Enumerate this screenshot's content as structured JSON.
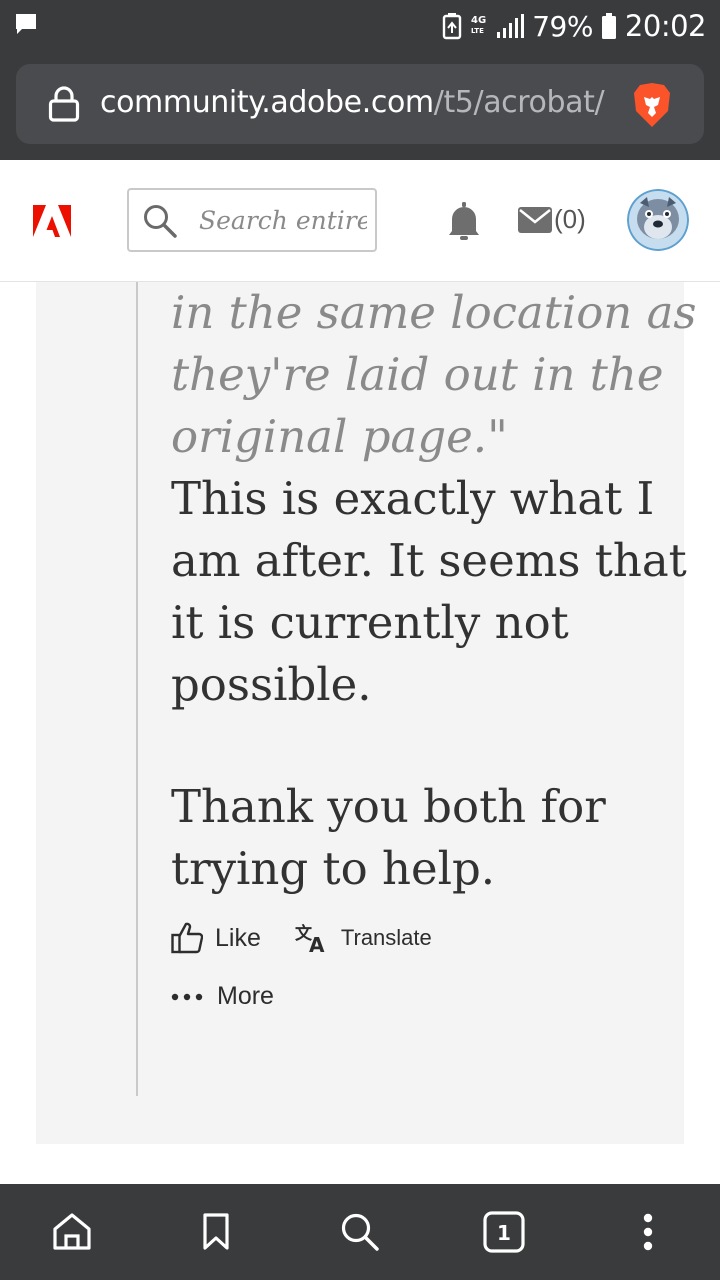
{
  "status_bar": {
    "network": "4G LTE",
    "battery_percent": "79%",
    "time": "20:02",
    "icons": [
      "chat-notification-icon",
      "battery-saver-icon",
      "signal-icon",
      "battery-icon"
    ]
  },
  "browser": {
    "url_domain": "community.adobe.com",
    "url_path": "/t5/acrobat/",
    "icons": [
      "lock-icon",
      "brave-lion-icon"
    ]
  },
  "header": {
    "logo": "adobe-logo",
    "search_placeholder": "Search entire c",
    "messages_count": "(0)",
    "icons": [
      "search-icon",
      "bell-icon",
      "mail-icon",
      "avatar"
    ]
  },
  "post": {
    "quote_lines": [
      "in the same location as",
      "they're laid out in the",
      "original page.\""
    ],
    "body_lines_1": [
      "This is exactly what I",
      "am after. It seems that",
      "it is currently not",
      "possible."
    ],
    "body_lines_2": [
      "Thank you both for",
      "trying to help."
    ],
    "actions": {
      "like": "Like",
      "translate": "Translate",
      "more": "More"
    }
  },
  "bottom_nav": {
    "tabs_count": "1",
    "icons": [
      "home-icon",
      "bookmark-icon",
      "search-icon",
      "tabs-icon",
      "menu-icon"
    ]
  },
  "colors": {
    "chrome_bg": "#3a3b3d",
    "url_box_bg": "#4a4b4e",
    "adobe_red": "#eb1000",
    "brave_orange": "#fb542b",
    "card_bg": "#f4f4f4",
    "quote_text": "#8a8a8a",
    "body_text": "#323232"
  }
}
